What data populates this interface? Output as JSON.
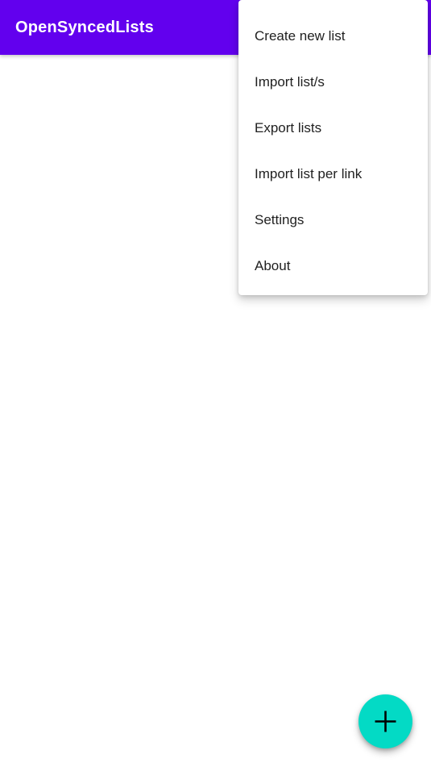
{
  "app": {
    "title": "OpenSyncedLists",
    "appbar_color": "#6200EE",
    "appbar_text_color": "#FFFFFF",
    "background_color": "#FFFFFF"
  },
  "menu": {
    "items": [
      {
        "label": "Create new list"
      },
      {
        "label": "Import list/s"
      },
      {
        "label": "Export lists"
      },
      {
        "label": "Import list per link"
      },
      {
        "label": "Settings"
      },
      {
        "label": "About"
      }
    ],
    "background_color": "#FFFFFF",
    "text_color": "#212121"
  },
  "fab": {
    "icon": "plus-icon",
    "color": "#03DAC5",
    "icon_color": "#000000"
  },
  "content": {
    "empty": ""
  }
}
